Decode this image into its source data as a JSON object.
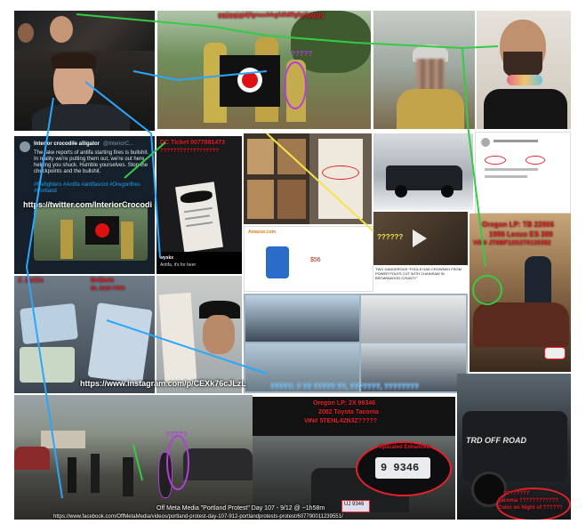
{
  "captions": {
    "top_collage": "?????",
    "top_collage_sub": "ggjjggjgjdjfgnuuhhgfdfdffgfgjfgggjg",
    "tweet_user": "Interior crocodile alligator",
    "tweet_handle": "@InteriorC...",
    "tweet_body": "The fake reports of antifa starting fires is bullshit. In reality we're putting them out, we're out here helping you shuck. Humble yourselves. Stop the checkpoints and the bullshit.",
    "tweet_tags": "#firefighters #Antifa #antifascist #Oregonfires #Portland",
    "tweet_url": "https://twitter.com/InteriorCrocodi",
    "dc_ticket": "DC Ticket 0077881473",
    "dc_ticket_sub": "??????????????????",
    "ad_title": "Amazon.com",
    "ad_price": "$56",
    "ad_caption": "TWO DANGEROUS \"FOOLS HAD CROWNED FROM POWER POLES CUT WITH CHAINSAW IN BROWNWOOD COUNTY\"",
    "insta_user": "wyskx",
    "insta_comment": "Antifa, it's for beer",
    "question_marks": "??????",
    "oregon_lp_1": "Oregon LP: TB 22006",
    "oregon_lp_2": "1996 Lexus ES 300",
    "oregon_lp_3": "VIN# JT8BF12G2T0130382",
    "license_label_1": "Z. ZaZZa",
    "license_label_2": "Brtibets",
    "license_sub": "DL 2020 FRRI",
    "insta_url": "https://www.instagram.com/p/CEXk76cJLzL",
    "mid_caption": "?????: ? ?? ????? ??, ???????, ????????",
    "oregon_lp_b1": "Oregon LP: 2X 99346",
    "oregon_lp_b2": "2002 Toyota Tacoma",
    "oregon_lp_b3": "VIN# 5TENL42N3Z?????",
    "plate_callout": "Upscaled Enhanced",
    "plate_number": "9 9346",
    "plate_small": "UJ 9346",
    "truck_badge": "TRD OFF ROAD",
    "truck_red_1": "????????",
    "truck_red_2": "Tacoma ????????????",
    "truck_red_3": "Color on Night of ??????",
    "purple_q": "?????",
    "footer_line_1": "Off Meta Media \"Portland Protest\" Day 107 - 9/12 @ ~1h58m",
    "footer_line_2": "https://www.facebook.com/OffMetaMedia/videos/portland-protest-day-107-912-portlandprotests-protest/607790011239551/"
  },
  "colors": {
    "green_line": "#33cc44",
    "blue_line": "#2aa6ff",
    "yellow_line": "#f3e54a",
    "red_text": "#e8202a",
    "purple_circle": "#b040d8"
  },
  "icons": [
    "antifa-flag-icon",
    "play-icon",
    "sticker-pencil-sharpener-icon"
  ]
}
